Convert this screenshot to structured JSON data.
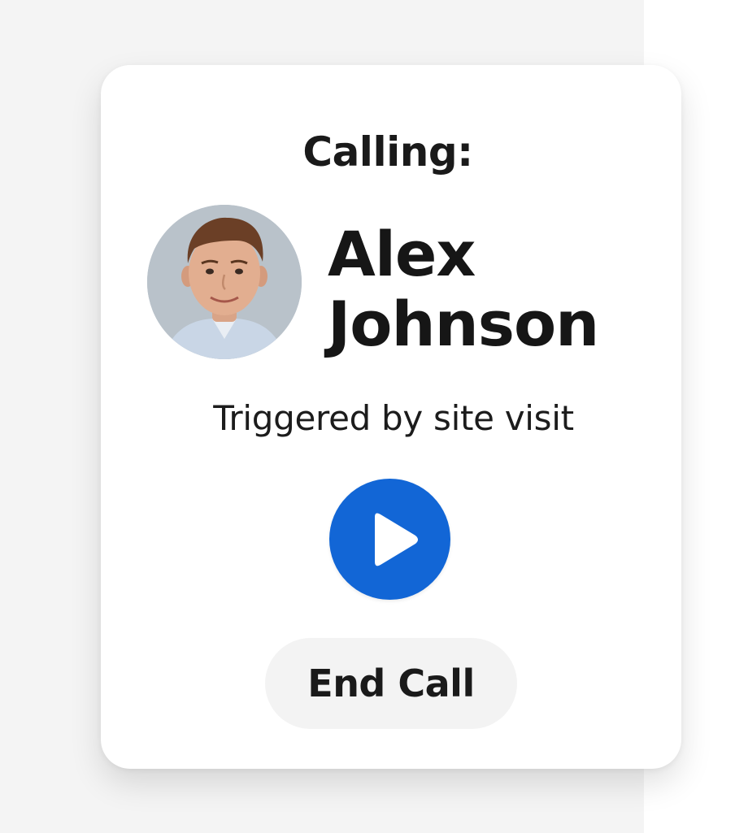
{
  "call_card": {
    "calling_label": "Calling:",
    "caller": {
      "name_first": "Alex",
      "name_last": "Johnson"
    },
    "trigger_text": "Triggered by site visit",
    "play_icon": "play-icon",
    "end_call_label": "End Call"
  },
  "colors": {
    "accent": "#1266d6",
    "end_call_background": "#f3f3f3",
    "card_background": "#ffffff",
    "page_background": "#f4f4f4"
  }
}
